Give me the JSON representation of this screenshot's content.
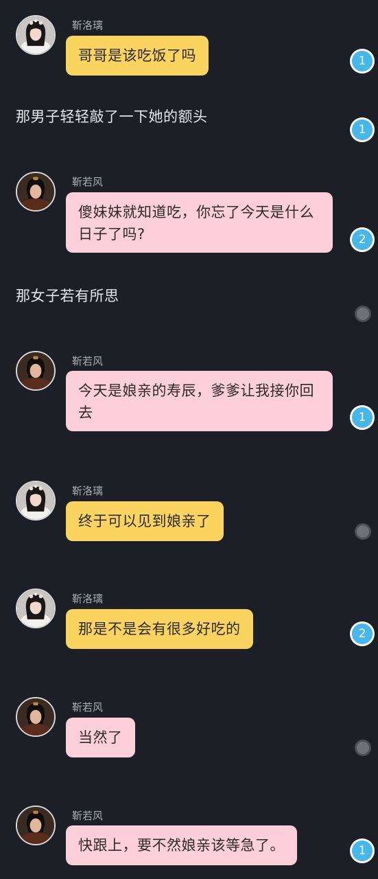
{
  "speakers": {
    "luoli": "靳洛璃",
    "ruofeng": "靳若风"
  },
  "messages": [
    {
      "kind": "bubble",
      "speaker": "靳洛璃",
      "avatar": "female-avatar-icon",
      "text": "哥哥是该吃饭了吗",
      "color": "#fbd35f",
      "indicator": "1"
    },
    {
      "kind": "narration",
      "text": "那男子轻轻敲了一下她的额头",
      "indicator": "1"
    },
    {
      "kind": "bubble",
      "speaker": "靳若风",
      "avatar": "male-avatar-icon",
      "text": "傻妹妹就知道吃，你忘了今天是什么日子了吗?",
      "color": "#fccfdb",
      "indicator": "2"
    },
    {
      "kind": "narration",
      "text": "那女子若有所思",
      "indicator": ""
    },
    {
      "kind": "bubble",
      "speaker": "靳若风",
      "avatar": "male-avatar-icon",
      "text": "今天是娘亲的寿辰，爹爹让我接你回去",
      "color": "#fccfdb",
      "indicator": "1"
    },
    {
      "kind": "bubble",
      "speaker": "靳洛璃",
      "avatar": "female-avatar-icon",
      "text": "终于可以见到娘亲了",
      "color": "#fbd35f",
      "indicator": ""
    },
    {
      "kind": "bubble",
      "speaker": "靳洛璃",
      "avatar": "female-avatar-icon",
      "text": "那是不是会有很多好吃的",
      "color": "#fbd35f",
      "indicator": "2"
    },
    {
      "kind": "bubble",
      "speaker": "靳若风",
      "avatar": "male-avatar-icon",
      "text": "当然了",
      "color": "#fccfdb",
      "indicator": ""
    },
    {
      "kind": "bubble",
      "speaker": "靳若风",
      "avatar": "male-avatar-icon",
      "text": "快跟上，要不然娘亲该等急了。",
      "color": "#fccfdb",
      "indicator": "1"
    }
  ],
  "colors": {
    "background": "#1c1f26",
    "badge": "#46b7ea",
    "dot": "#6e7178"
  }
}
